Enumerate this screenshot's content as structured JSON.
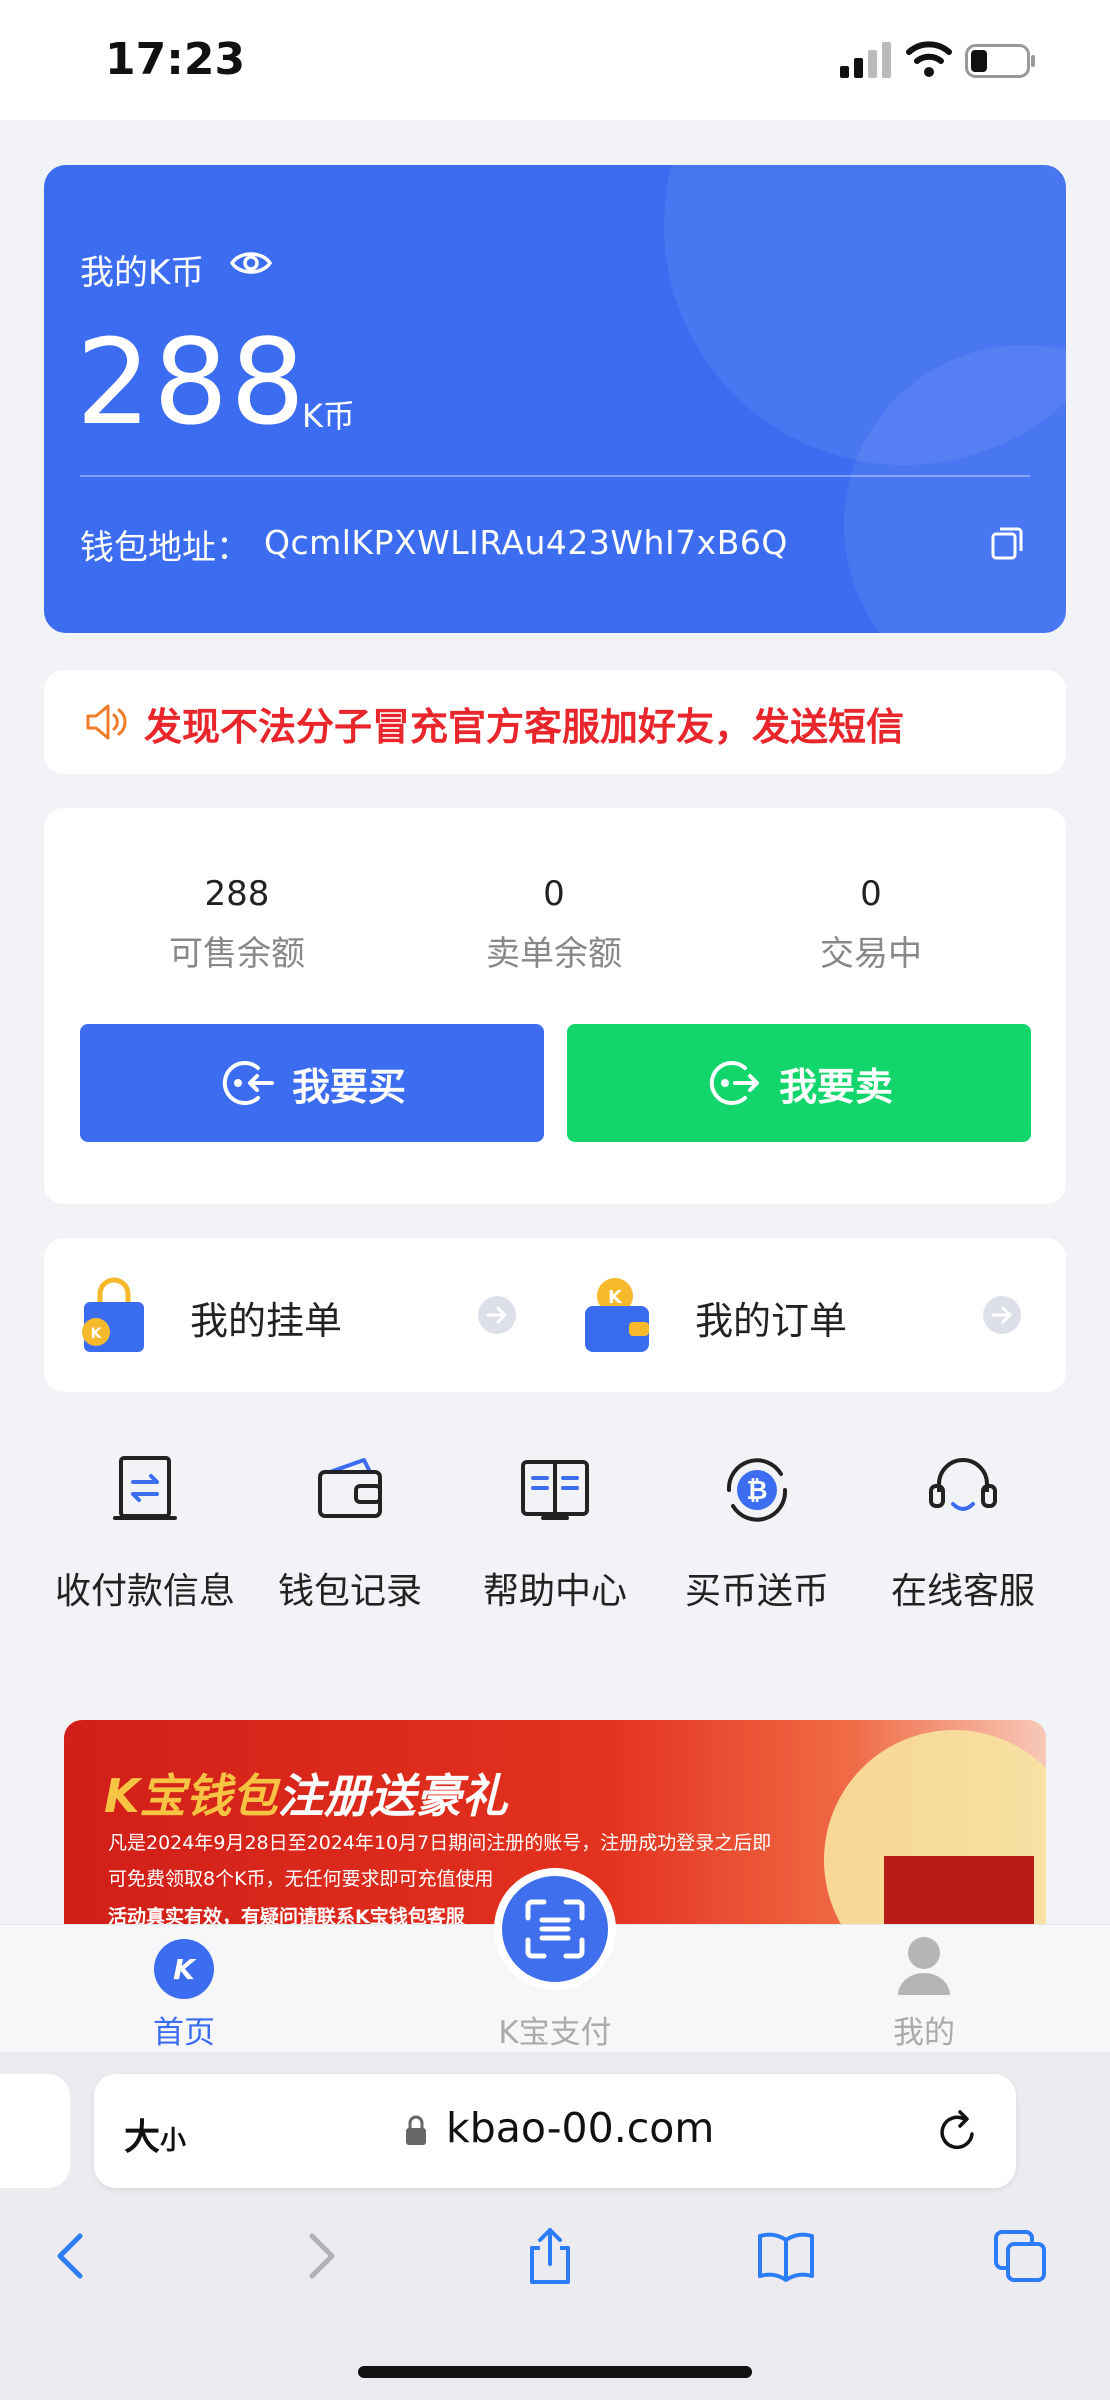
{
  "status_bar": {
    "time": "17:23"
  },
  "wallet": {
    "title": "我的K币",
    "balance": "288",
    "unit": "K币",
    "address_label": "钱包地址：",
    "address": "QcmlKPXWLIRAu423WhI7xB6Q"
  },
  "notice": {
    "text": "发现不法分子冒充官方客服加好友，发送短信"
  },
  "stats": [
    {
      "value": "288",
      "label": "可售余额"
    },
    {
      "value": "0",
      "label": "卖单余额"
    },
    {
      "value": "0",
      "label": "交易中"
    }
  ],
  "actions": {
    "buy": "我要买",
    "sell": "我要卖"
  },
  "orders": {
    "my_listings": "我的挂单",
    "my_orders": "我的订单"
  },
  "quick_links": [
    {
      "label": "收付款信息",
      "icon": "receipt-icon"
    },
    {
      "label": "钱包记录",
      "icon": "wallet-icon"
    },
    {
      "label": "帮助中心",
      "icon": "book-icon"
    },
    {
      "label": "买币送币",
      "icon": "bitcoin-icon"
    },
    {
      "label": "在线客服",
      "icon": "headset-icon"
    }
  ],
  "banner": {
    "brand": "K宝钱包",
    "title_suffix": "注册送豪礼",
    "line1": "凡是2024年9月28日至2024年10月7日期间注册的账号，注册成功登录之后即",
    "line2": "可免费领取8个K币，无任何要求即可充值使用",
    "line3": "活动真实有效，有疑问请联系K宝钱包客服"
  },
  "tabbar": {
    "home": "首页",
    "pay": "K宝支付",
    "mine": "我的"
  },
  "browser": {
    "text_size": "大",
    "text_size_small": "小",
    "url": "kbao-00.com"
  },
  "colors": {
    "primary": "#3c6cf0",
    "sell": "#12d66b",
    "alert": "#e8262b"
  }
}
